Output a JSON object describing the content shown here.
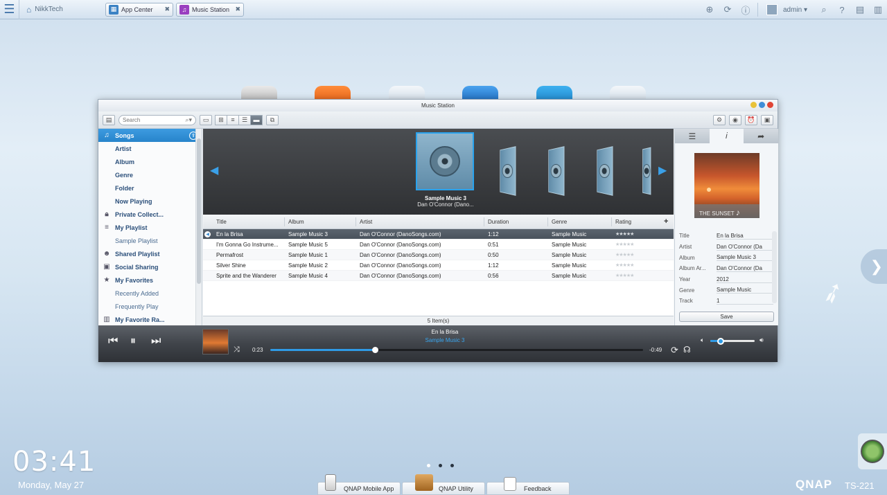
{
  "topbar": {
    "home_label": "NikkTech",
    "tabs": [
      {
        "label": "App Center",
        "close": "✖"
      },
      {
        "label": "Music Station",
        "close": "✖"
      }
    ],
    "user": "admin"
  },
  "window": {
    "title": "Music Station",
    "search_placeholder": "Search"
  },
  "sidebar": {
    "items": [
      {
        "label": "Songs"
      },
      {
        "label": "Artist"
      },
      {
        "label": "Album"
      },
      {
        "label": "Genre"
      },
      {
        "label": "Folder"
      },
      {
        "label": "Now Playing"
      },
      {
        "label": "Private Collect..."
      },
      {
        "label": "My Playlist"
      },
      {
        "label": "Sample Playlist"
      },
      {
        "label": "Shared Playlist"
      },
      {
        "label": "Social Sharing"
      },
      {
        "label": "My Favorites"
      },
      {
        "label": "Recently Added"
      },
      {
        "label": "Frequently Play"
      },
      {
        "label": "My Favorite Ra..."
      }
    ]
  },
  "coverflow": {
    "title": "Sample Music 3",
    "subtitle": "Dan O'Connor (Dano..."
  },
  "table": {
    "columns": [
      "Title",
      "Album",
      "Artist",
      "Duration",
      "Genre",
      "Rating",
      "+"
    ],
    "rows": [
      {
        "title": "En la Brisa",
        "album": "Sample Music 3",
        "artist": "Dan O'Connor (DanoSongs.com)",
        "duration": "1:12",
        "genre": "Sample Music",
        "rating": "★★★★★"
      },
      {
        "title": "I'm Gonna Go Instrume...",
        "album": "Sample Music 5",
        "artist": "Dan O'Connor (DanoSongs.com)",
        "duration": "0:51",
        "genre": "Sample Music",
        "rating": "★★★★★"
      },
      {
        "title": "Permafrost",
        "album": "Sample Music 1",
        "artist": "Dan O'Connor (DanoSongs.com)",
        "duration": "0:50",
        "genre": "Sample Music",
        "rating": "★★★★★"
      },
      {
        "title": "Silver Shine",
        "album": "Sample Music 2",
        "artist": "Dan O'Connor (DanoSongs.com)",
        "duration": "1:12",
        "genre": "Sample Music",
        "rating": "★★★★★"
      },
      {
        "title": "Sprite and the Wanderer",
        "album": "Sample Music 4",
        "artist": "Dan O'Connor (DanoSongs.com)",
        "duration": "0:56",
        "genre": "Sample Music",
        "rating": "★★★★★"
      }
    ],
    "footer": "5 Item(s)"
  },
  "details": {
    "art_caption": "THE SUNSET",
    "fields": [
      {
        "key": "Title",
        "value": "En la Brisa"
      },
      {
        "key": "Artist",
        "value": "Dan O'Connor (Da"
      },
      {
        "key": "Album",
        "value": "Sample Music 3"
      },
      {
        "key": "Album Ar...",
        "value": "Dan O'Connor (Da"
      },
      {
        "key": "Year",
        "value": "2012"
      },
      {
        "key": "Genre",
        "value": "Sample Music"
      },
      {
        "key": "Track",
        "value": "1"
      }
    ],
    "save_label": "Save"
  },
  "player": {
    "title": "En la Brisa",
    "album": "Sample Music 3",
    "elapsed": "0:23",
    "remaining": "-0:49",
    "progress_fraction": 0.28,
    "volume_fraction": 0.24
  },
  "desktop": {
    "time": "03:41",
    "date": "Monday, May 27",
    "dock": [
      "QNAP Mobile App",
      "QNAP Utility",
      "Feedback"
    ],
    "brand": "QNAP",
    "model": "TS-221"
  }
}
